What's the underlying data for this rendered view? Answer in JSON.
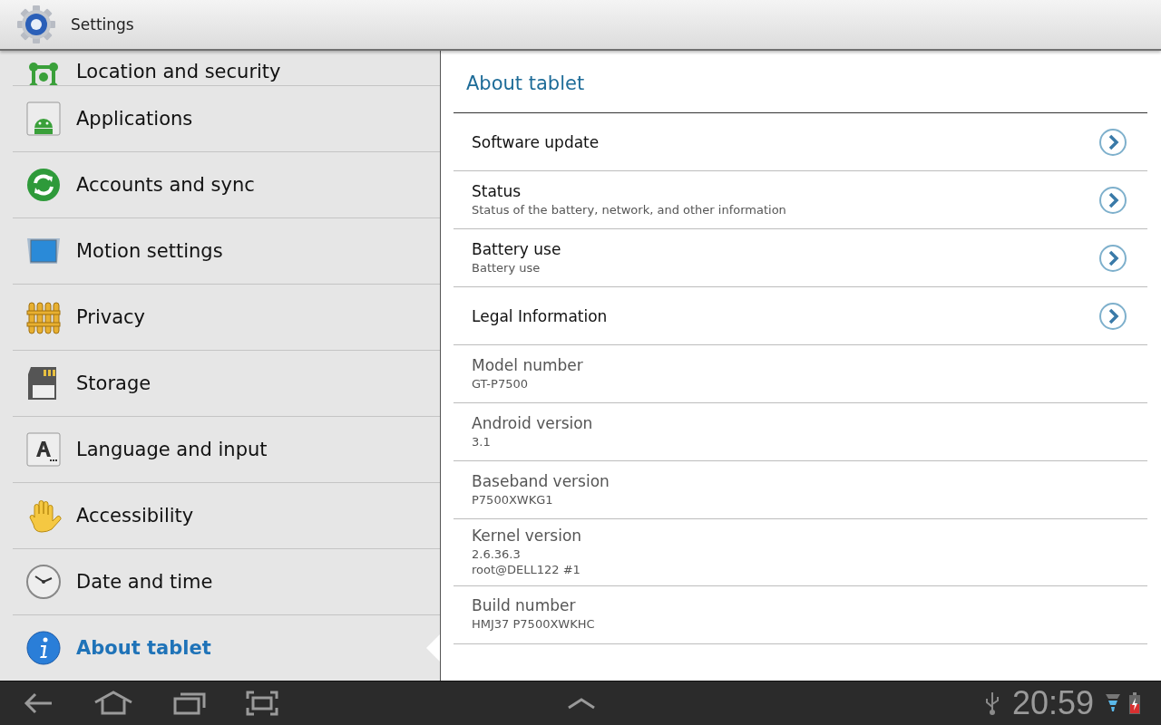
{
  "action_bar": {
    "title": "Settings"
  },
  "sidebar": {
    "items": [
      {
        "label": "Location and security",
        "selected": false
      },
      {
        "label": "Applications",
        "selected": false
      },
      {
        "label": "Accounts and sync",
        "selected": false
      },
      {
        "label": "Motion settings",
        "selected": false
      },
      {
        "label": "Privacy",
        "selected": false
      },
      {
        "label": "Storage",
        "selected": false
      },
      {
        "label": "Language and input",
        "selected": false
      },
      {
        "label": "Accessibility",
        "selected": false
      },
      {
        "label": "Date and time",
        "selected": false
      },
      {
        "label": "About tablet",
        "selected": true
      }
    ]
  },
  "detail": {
    "title": "About tablet",
    "items": [
      {
        "kind": "link",
        "title": "Software update"
      },
      {
        "kind": "link",
        "title": "Status",
        "summary": "Status of the battery, network, and other information"
      },
      {
        "kind": "link",
        "title": "Battery use",
        "summary": "Battery use"
      },
      {
        "kind": "link",
        "title": "Legal Information"
      },
      {
        "kind": "info",
        "title": "Model number",
        "summary": "GT-P7500"
      },
      {
        "kind": "info",
        "title": "Android version",
        "summary": "3.1"
      },
      {
        "kind": "info",
        "title": "Baseband version",
        "summary": "P7500XWKG1"
      },
      {
        "kind": "info",
        "title": "Kernel version",
        "summary": "2.6.36.3\nroot@DELL122 #1"
      },
      {
        "kind": "info",
        "title": "Build number",
        "summary": "HMJ37 P7500XWKHC"
      }
    ]
  },
  "system_bar": {
    "clock": "20:59"
  }
}
